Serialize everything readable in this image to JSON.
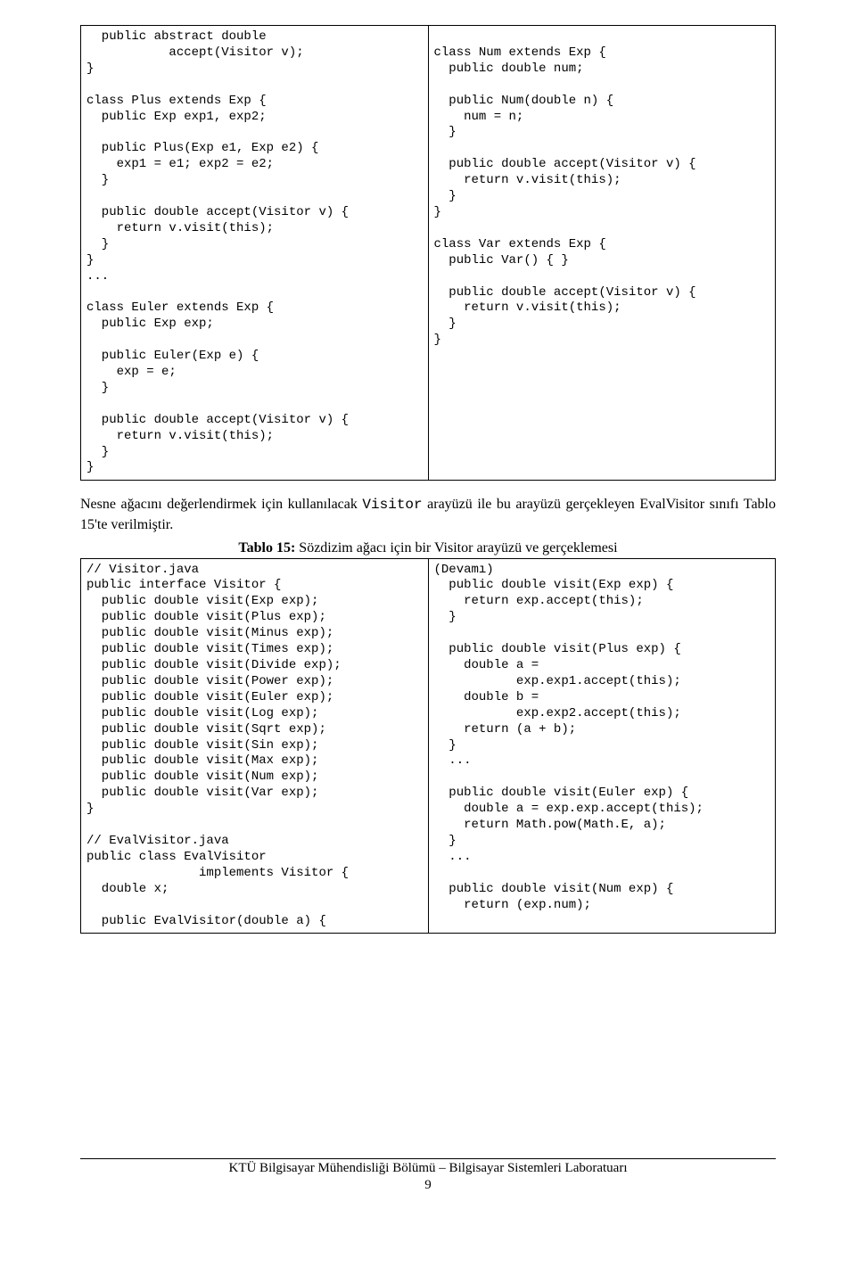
{
  "box1": {
    "left": "  public abstract double\n           accept(Visitor v);\n}\n\nclass Plus extends Exp {\n  public Exp exp1, exp2;\n\n  public Plus(Exp e1, Exp e2) {\n    exp1 = e1; exp2 = e2;\n  }\n\n  public double accept(Visitor v) {\n    return v.visit(this);\n  }\n}\n...\n\nclass Euler extends Exp {\n  public Exp exp;\n\n  public Euler(Exp e) {\n    exp = e;\n  }\n\n  public double accept(Visitor v) {\n    return v.visit(this);\n  }\n}",
    "right": "\nclass Num extends Exp {\n  public double num;\n\n  public Num(double n) {\n    num = n;\n  }\n\n  public double accept(Visitor v) {\n    return v.visit(this);\n  }\n}\n\nclass Var extends Exp {\n  public Var() { }\n\n  public double accept(Visitor v) {\n    return v.visit(this);\n  }\n}"
  },
  "para": {
    "pre1": "Nesne ağacını değerlendirmek için kullanılacak ",
    "mono1": "Visitor",
    "mid1": " arayüzü ile bu arayüzü gerçekleyen EvalVisitor sınıfı Tablo 15'te verilmiştir."
  },
  "caption": {
    "bold": "Tablo 15:",
    "rest": " Sözdizim ağacı için bir Visitor arayüzü ve gerçeklemesi"
  },
  "box2": {
    "left": "// Visitor.java\npublic interface Visitor {\n  public double visit(Exp exp);\n  public double visit(Plus exp);\n  public double visit(Minus exp);\n  public double visit(Times exp);\n  public double visit(Divide exp);\n  public double visit(Power exp);\n  public double visit(Euler exp);\n  public double visit(Log exp);\n  public double visit(Sqrt exp);\n  public double visit(Sin exp);\n  public double visit(Max exp);\n  public double visit(Num exp);\n  public double visit(Var exp);\n}\n\n// EvalVisitor.java\npublic class EvalVisitor\n               implements Visitor {\n  double x;\n\n  public EvalVisitor(double a) {",
    "right": "(Devamı)\n  public double visit(Exp exp) {\n    return exp.accept(this);\n  }\n\n  public double visit(Plus exp) {\n    double a =\n           exp.exp1.accept(this);\n    double b =\n           exp.exp2.accept(this);\n    return (a + b);\n  }\n  ...\n\n  public double visit(Euler exp) {\n    double a = exp.exp.accept(this);\n    return Math.pow(Math.E, a);\n  }\n  ...\n\n  public double visit(Num exp) {\n    return (exp.num);"
  },
  "footer": {
    "text": "KTÜ Bilgisayar Mühendisliği Bölümü – Bilgisayar Sistemleri Laboratuarı",
    "page": "9"
  }
}
